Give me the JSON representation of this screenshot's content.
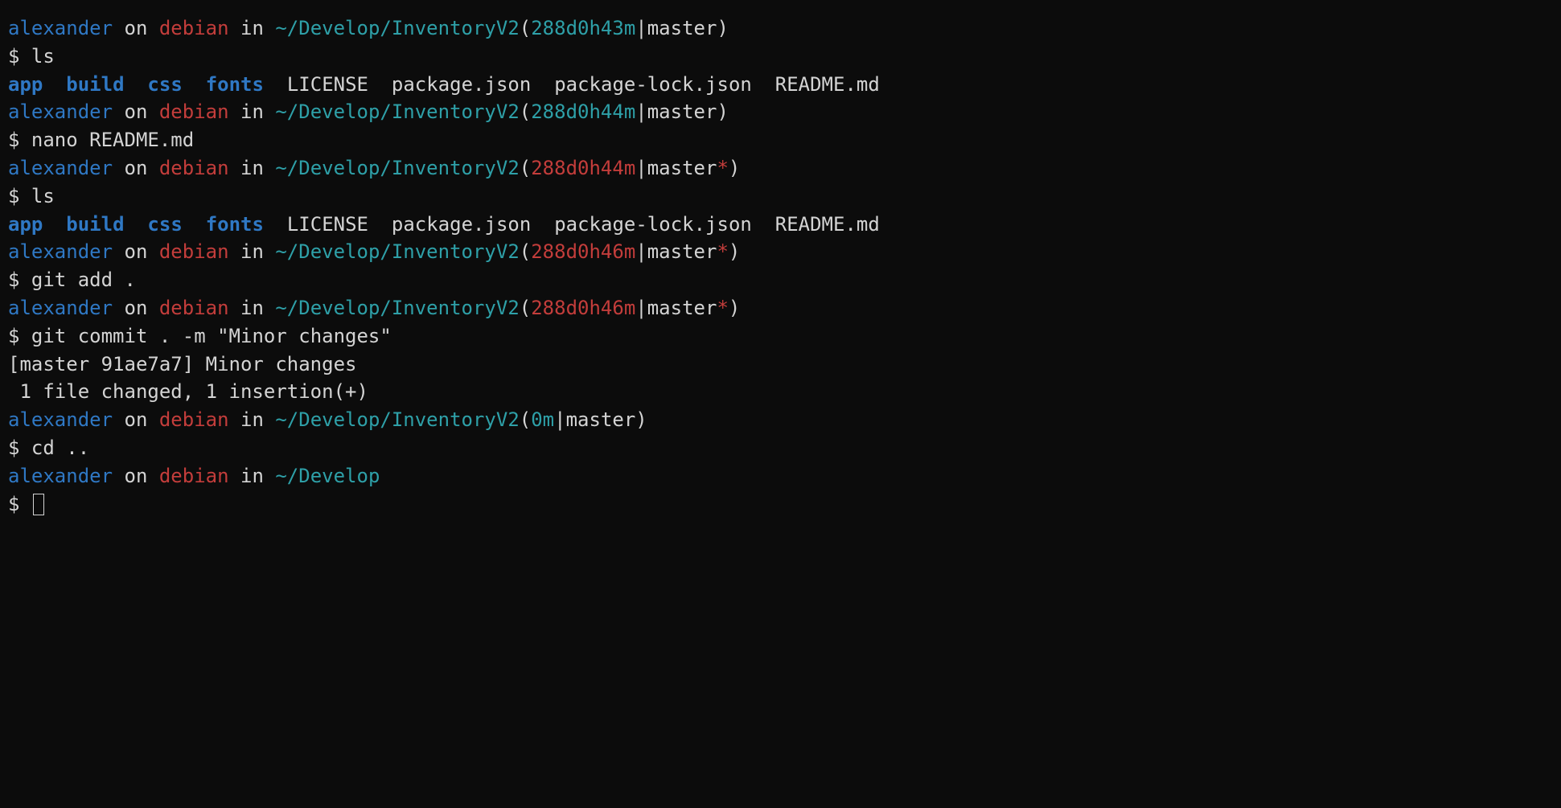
{
  "colors": {
    "bg": "#0c0c0c",
    "fg": "#d4d4d4",
    "user": "#2f78c4",
    "host": "#c33d3b",
    "path": "#2ea0a8",
    "time_clean": "#2ea0a8",
    "time_dirty": "#c33d3b",
    "dir": "#2f78c4",
    "star": "#c33d3b"
  },
  "tokens": {
    "on": "on",
    "in": "in",
    "prompt": "$"
  },
  "ls": {
    "dirs": {
      "d0": "app",
      "d1": "build",
      "d2": "css",
      "d3": "fonts"
    },
    "files": {
      "f0": "LICENSE",
      "f1": "package.json",
      "f2": "package-lock.json",
      "f3": "README.md"
    }
  },
  "blocks": [
    {
      "prompt": {
        "user": "alexander",
        "host": "debian",
        "path": "~/Develop/InventoryV2",
        "time": "288d0h43m",
        "time_dirty": false,
        "branch": "master",
        "star": false,
        "has_repo": true
      },
      "command": "ls",
      "output": {
        "type": "ls"
      }
    },
    {
      "prompt": {
        "user": "alexander",
        "host": "debian",
        "path": "~/Develop/InventoryV2",
        "time": "288d0h44m",
        "time_dirty": false,
        "branch": "master",
        "star": false,
        "has_repo": true
      },
      "command": "nano README.md",
      "output": {
        "type": "none"
      }
    },
    {
      "prompt": {
        "user": "alexander",
        "host": "debian",
        "path": "~/Develop/InventoryV2",
        "time": "288d0h44m",
        "time_dirty": true,
        "branch": "master",
        "star": true,
        "has_repo": true
      },
      "command": "ls",
      "output": {
        "type": "ls"
      }
    },
    {
      "prompt": {
        "user": "alexander",
        "host": "debian",
        "path": "~/Develop/InventoryV2",
        "time": "288d0h46m",
        "time_dirty": true,
        "branch": "master",
        "star": true,
        "has_repo": true
      },
      "command": "git add .",
      "output": {
        "type": "none"
      }
    },
    {
      "prompt": {
        "user": "alexander",
        "host": "debian",
        "path": "~/Develop/InventoryV2",
        "time": "288d0h46m",
        "time_dirty": true,
        "branch": "master",
        "star": true,
        "has_repo": true
      },
      "command": "git commit . -m \"Minor changes\"",
      "output": {
        "type": "commit"
      }
    },
    {
      "prompt": {
        "user": "alexander",
        "host": "debian",
        "path": "~/Develop/InventoryV2",
        "time": "0m",
        "time_dirty": false,
        "branch": "master",
        "star": false,
        "has_repo": true
      },
      "command": "cd ..",
      "output": {
        "type": "none"
      }
    },
    {
      "prompt": {
        "user": "alexander",
        "host": "debian",
        "path": "~/Develop",
        "has_repo": false
      },
      "command": "",
      "cursor": true,
      "output": {
        "type": "none"
      }
    }
  ],
  "commit": {
    "line1": "[master 91ae7a7] Minor changes",
    "line2": " 1 file changed, 1 insertion(+)"
  }
}
